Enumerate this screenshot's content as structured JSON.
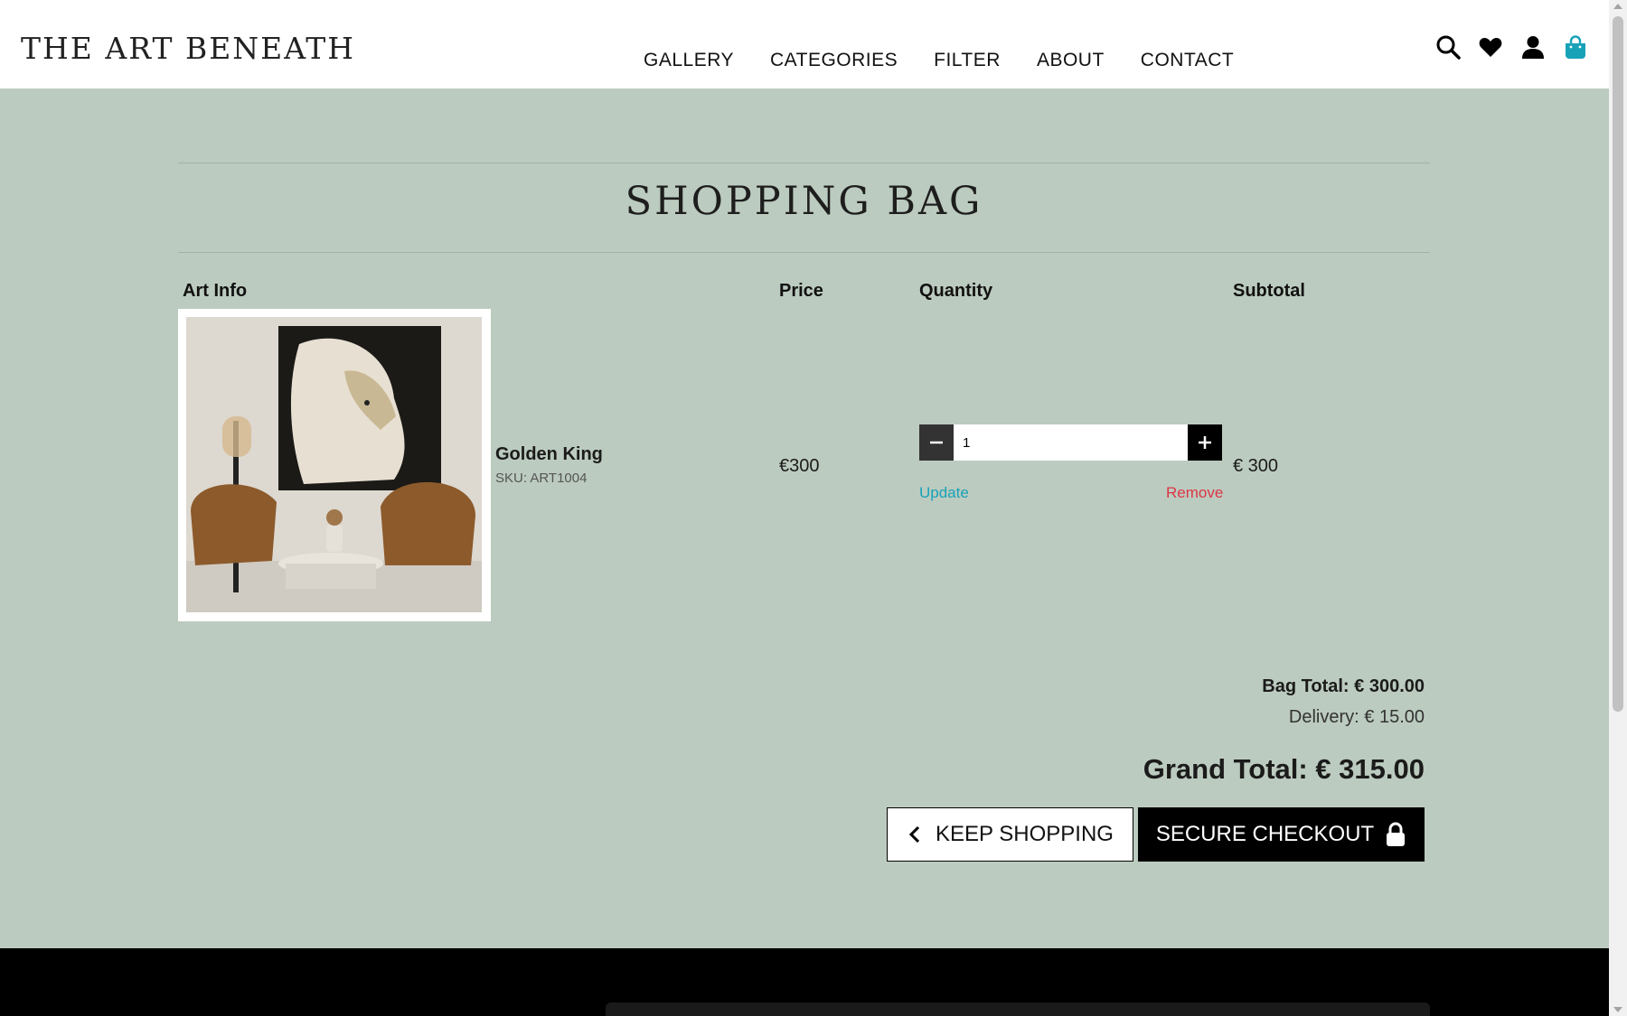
{
  "brand": {
    "logo": "THE ART BENEATH"
  },
  "nav": {
    "items": [
      "GALLERY",
      "CATEGORIES",
      "FILTER",
      "ABOUT",
      "CONTACT"
    ]
  },
  "header_icons": [
    "search-icon",
    "heart-icon",
    "user-icon",
    "shopping-bag-icon"
  ],
  "page": {
    "title": "SHOPPING BAG"
  },
  "table": {
    "headers": {
      "art_info": "Art Info",
      "price": "Price",
      "quantity": "Quantity",
      "subtotal": "Subtotal"
    }
  },
  "item": {
    "name": "Golden King",
    "sku": "SKU: ART1004",
    "price": "€300",
    "quantity": "1",
    "subtotal": "€ 300",
    "update_label": "Update",
    "remove_label": "Remove"
  },
  "totals": {
    "bag_total": "Bag Total: € 300.00",
    "delivery": "Delivery: € 15.00",
    "grand_total": "Grand Total: € 315.00"
  },
  "actions": {
    "keep_shopping": "KEEP SHOPPING",
    "secure_checkout": "SECURE CHECKOUT"
  },
  "colors": {
    "page_bg": "#bccbbf",
    "bag_icon": "#17a2b8",
    "update_link": "#17a2b8",
    "remove_link": "#dc3545"
  }
}
